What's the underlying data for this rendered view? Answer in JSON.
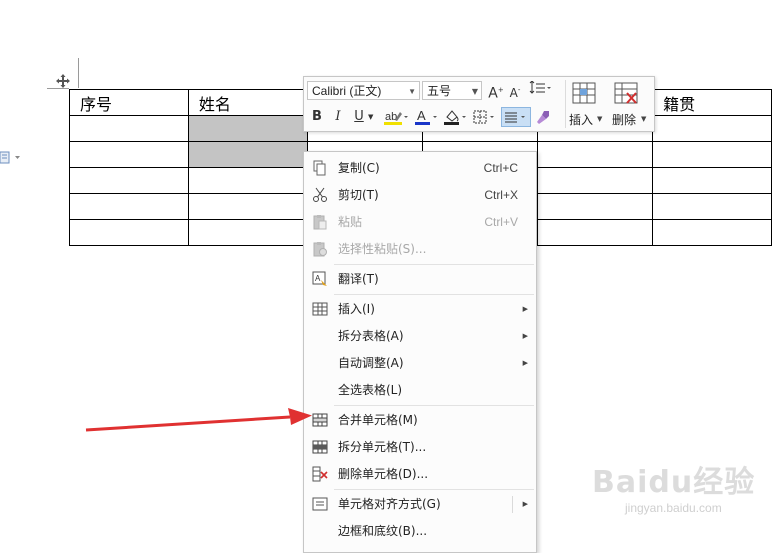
{
  "table": {
    "headers": [
      "序号",
      "姓名",
      "",
      "",
      "",
      "籍贯"
    ]
  },
  "toolbar": {
    "font_name": "Calibri (正文)",
    "font_size": "五号",
    "bold": "B",
    "italic": "I",
    "underline": "U",
    "insert_label": "插入",
    "delete_label": "删除",
    "highlight_color": "#f0e000",
    "font_color": "#1a36c8",
    "delete_icon_color": "#d12f2f"
  },
  "context_menu": {
    "items": [
      {
        "label": "复制(C)",
        "shortcut": "Ctrl+C",
        "icon": "copy-icon"
      },
      {
        "label": "剪切(T)",
        "shortcut": "Ctrl+X",
        "icon": "scissors-icon"
      },
      {
        "label": "粘贴",
        "shortcut": "Ctrl+V",
        "icon": "paste-icon",
        "disabled": true
      },
      {
        "label": "选择性粘贴(S)...",
        "icon": "paste-special-icon",
        "disabled": true
      },
      {
        "label": "翻译(T)",
        "icon": "translate-icon"
      },
      {
        "label": "插入(I)",
        "icon": "table-insert-icon",
        "submenu": true
      },
      {
        "label": "拆分表格(A)",
        "submenu": true
      },
      {
        "label": "自动调整(A)",
        "submenu": true
      },
      {
        "label": "全选表格(L)"
      },
      {
        "label": "合并单元格(M)",
        "icon": "merge-cells-icon"
      },
      {
        "label": "拆分单元格(T)...",
        "icon": "split-cells-icon"
      },
      {
        "label": "删除单元格(D)...",
        "icon": "delete-cells-icon"
      },
      {
        "label": "单元格对齐方式(G)",
        "icon": "cell-align-icon",
        "submenu": true
      },
      {
        "label": "边框和底纹(B)..."
      }
    ]
  },
  "annotation": {
    "arrow_color": "#e03131"
  },
  "watermark": {
    "brand": "Baidu经验",
    "url": "jingyan.baidu.com"
  }
}
